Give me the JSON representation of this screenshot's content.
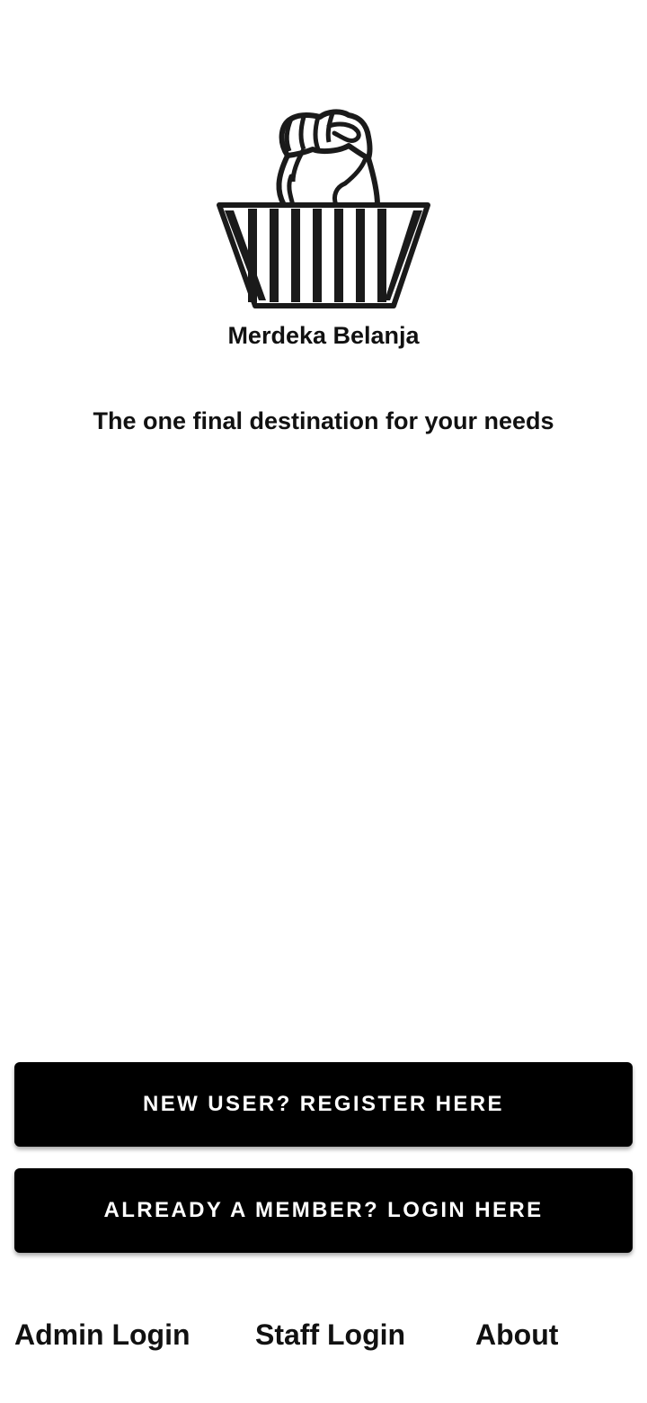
{
  "app": {
    "brand_name": "Merdeka Belanja",
    "tagline": "The one final destination for your needs",
    "logo_icon": "fist-basket-icon"
  },
  "actions": {
    "register_label": "NEW USER? REGISTER HERE",
    "login_label": "ALREADY A MEMBER? LOGIN HERE"
  },
  "footer": {
    "admin_login": "Admin Login",
    "staff_login": "Staff Login",
    "about": "About"
  },
  "colors": {
    "background": "#ffffff",
    "button_bg": "#000000",
    "button_text": "#ffffff",
    "text": "#111111"
  }
}
